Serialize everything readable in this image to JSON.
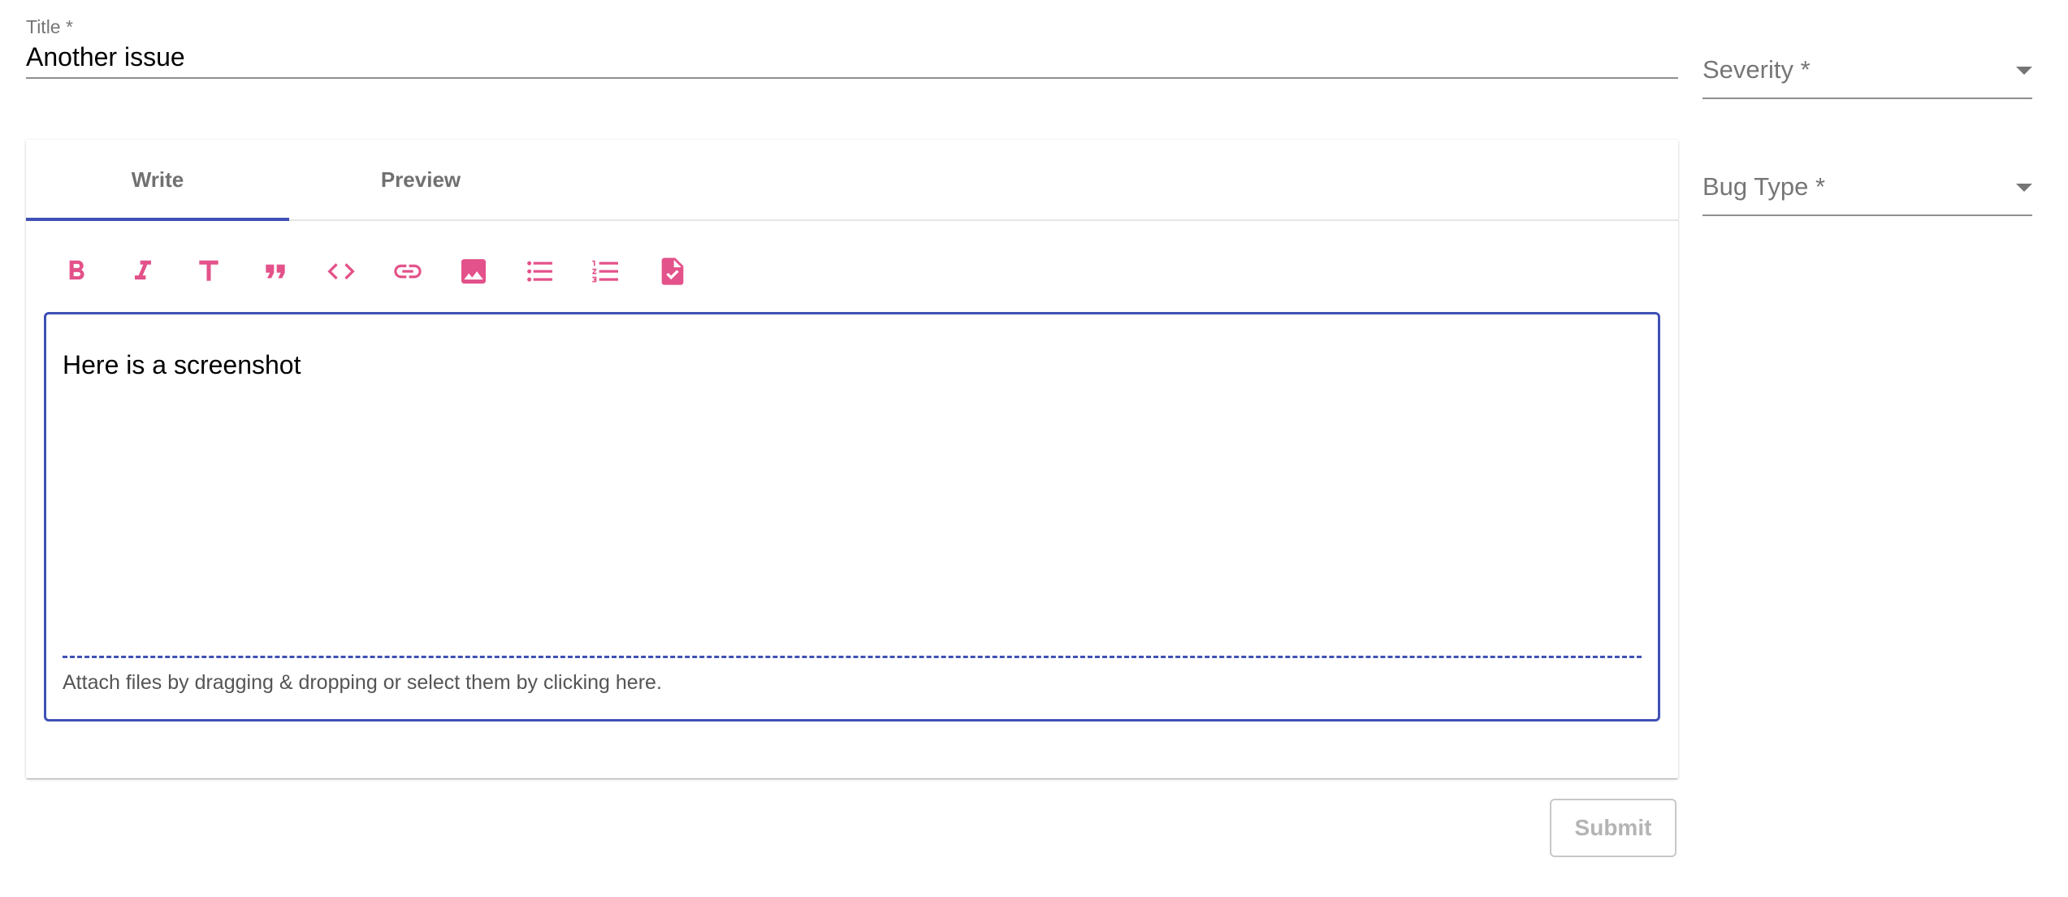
{
  "form": {
    "title": {
      "label": "Title *",
      "value": "Another issue"
    },
    "severity": {
      "label": "Severity *"
    },
    "bug_type": {
      "label": "Bug Type *"
    }
  },
  "editor": {
    "tabs": [
      {
        "label": "Write",
        "active": true
      },
      {
        "label": "Preview",
        "active": false
      }
    ],
    "toolbar": [
      {
        "icon": "bold-icon"
      },
      {
        "icon": "italic-icon"
      },
      {
        "icon": "header-icon"
      },
      {
        "icon": "quote-icon"
      },
      {
        "icon": "code-icon"
      },
      {
        "icon": "link-icon"
      },
      {
        "icon": "image-icon"
      },
      {
        "icon": "bulleted-list-icon"
      },
      {
        "icon": "numbered-list-icon"
      },
      {
        "icon": "checklist-file-icon"
      }
    ],
    "content": "Here is a screenshot",
    "dropzone_text": "Attach files by dragging & dropping or select them by clicking here."
  },
  "actions": {
    "submit_label": "Submit",
    "submit_disabled": true
  },
  "colors": {
    "accent": "#3f51b5",
    "icon": "#e3528a",
    "muted": "#757575"
  }
}
